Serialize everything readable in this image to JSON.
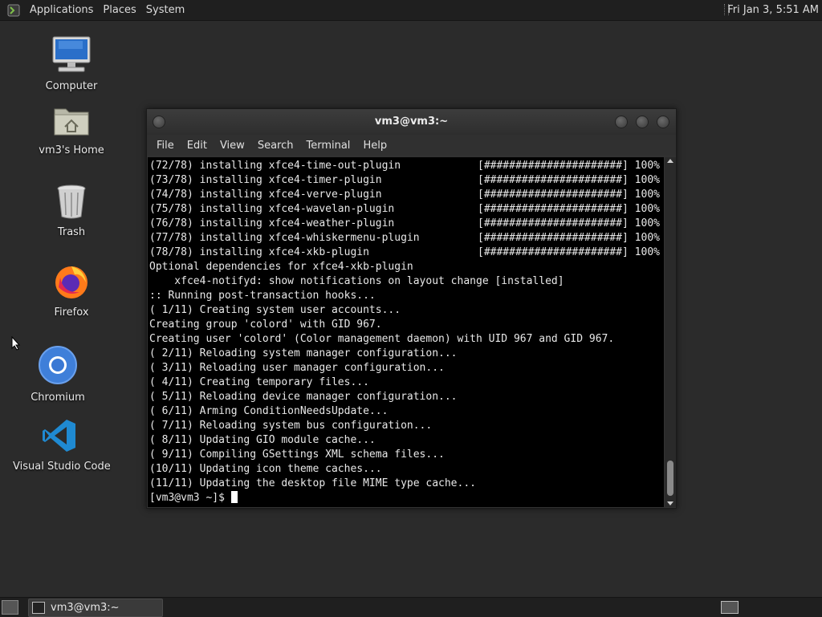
{
  "top_panel": {
    "menus": [
      "Applications",
      "Places",
      "System"
    ],
    "clock": "Fri Jan  3,  5:51 AM"
  },
  "desktop_icons": [
    {
      "label": "Computer",
      "icon": "computer-icon"
    },
    {
      "label": "vm3's Home",
      "icon": "home-folder-icon"
    },
    {
      "label": "Trash",
      "icon": "trash-icon"
    },
    {
      "label": "Firefox",
      "icon": "firefox-icon"
    },
    {
      "label": "Chromium",
      "icon": "chromium-icon"
    },
    {
      "label": "Visual Studio Code",
      "icon": "vscode-icon"
    }
  ],
  "terminal": {
    "title": "vm3@vm3:~",
    "menu": [
      "File",
      "Edit",
      "View",
      "Search",
      "Terminal",
      "Help"
    ],
    "install_lines": [
      {
        "text": "(72/78) installing xfce4-time-out-plugin",
        "bar": "[######################] 100%"
      },
      {
        "text": "(73/78) installing xfce4-timer-plugin",
        "bar": "[######################] 100%"
      },
      {
        "text": "(74/78) installing xfce4-verve-plugin",
        "bar": "[######################] 100%"
      },
      {
        "text": "(75/78) installing xfce4-wavelan-plugin",
        "bar": "[######################] 100%"
      },
      {
        "text": "(76/78) installing xfce4-weather-plugin",
        "bar": "[######################] 100%"
      },
      {
        "text": "(77/78) installing xfce4-whiskermenu-plugin",
        "bar": "[######################] 100%"
      },
      {
        "text": "(78/78) installing xfce4-xkb-plugin",
        "bar": "[######################] 100%"
      }
    ],
    "output_lines": [
      "Optional dependencies for xfce4-xkb-plugin",
      "    xfce4-notifyd: show notifications on layout change [installed]",
      ":: Running post-transaction hooks...",
      "( 1/11) Creating system user accounts...",
      "Creating group 'colord' with GID 967.",
      "Creating user 'colord' (Color management daemon) with UID 967 and GID 967.",
      "( 2/11) Reloading system manager configuration...",
      "( 3/11) Reloading user manager configuration...",
      "( 4/11) Creating temporary files...",
      "( 5/11) Reloading device manager configuration...",
      "( 6/11) Arming ConditionNeedsUpdate...",
      "( 7/11) Reloading system bus configuration...",
      "( 8/11) Updating GIO module cache...",
      "( 9/11) Compiling GSettings XML schema files...",
      "(10/11) Updating icon theme caches...",
      "(11/11) Updating the desktop file MIME type cache..."
    ],
    "prompt": "[vm3@vm3 ~]$ "
  },
  "taskbar": {
    "task_label": "vm3@vm3:~"
  }
}
